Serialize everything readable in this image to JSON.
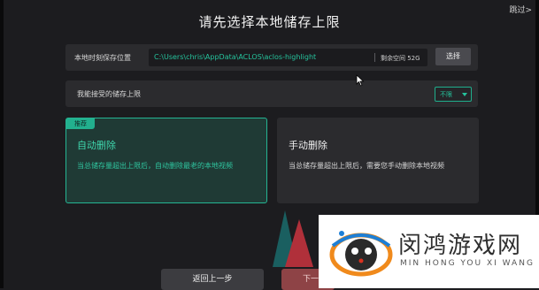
{
  "header": {
    "title": "请先选择本地储存上限",
    "skip_label": "跳过>"
  },
  "storage_location": {
    "label": "本地时刻保存位置",
    "path": "C:\\Users\\chris\\AppData\\ACLOS\\aclos-highlight",
    "free_space": "剩余空间 52G",
    "choose_label": "选择"
  },
  "storage_limit": {
    "label": "我能接受的储存上限",
    "selected": "不限"
  },
  "options": {
    "auto": {
      "badge": "推荐",
      "title": "自动删除",
      "description": "当总储存量超出上限后，自动删除最老的本地视频"
    },
    "manual": {
      "title": "手动删除",
      "description": "当总储存量超出上限后，需要您手动删除本地视频"
    }
  },
  "footer": {
    "back_label": "返回上一步",
    "next_label": "下一"
  },
  "watermark": {
    "cn": "闵鸿游戏网",
    "en": "MIN HONG YOU XI WANG"
  },
  "colors": {
    "accent": "#25c39c",
    "background": "#1c1c1f",
    "panel": "#2b2b2e"
  }
}
